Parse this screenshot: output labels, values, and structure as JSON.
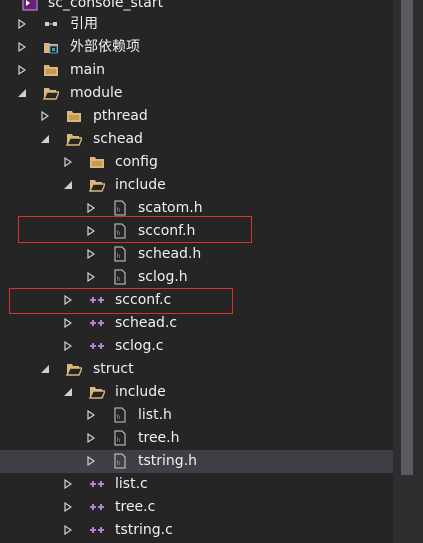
{
  "tree": {
    "items": [
      {
        "label": "sc_console_start",
        "icon": "solution-icon",
        "arrow": "none"
      },
      {
        "label": "引用",
        "icon": "references-icon",
        "arrow": "collapsed"
      },
      {
        "label": "外部依赖项",
        "icon": "external-deps-icon",
        "arrow": "collapsed"
      },
      {
        "label": "main",
        "icon": "folder-icon",
        "arrow": "collapsed"
      },
      {
        "label": "module",
        "icon": "folder-open-icon",
        "arrow": "expanded"
      },
      {
        "label": "pthread",
        "icon": "folder-icon",
        "arrow": "collapsed"
      },
      {
        "label": "schead",
        "icon": "folder-open-icon",
        "arrow": "expanded"
      },
      {
        "label": "config",
        "icon": "folder-icon",
        "arrow": "collapsed"
      },
      {
        "label": "include",
        "icon": "folder-open-icon",
        "arrow": "expanded"
      },
      {
        "label": "scatom.h",
        "icon": "header-file-icon",
        "arrow": "collapsed"
      },
      {
        "label": "scconf.h",
        "icon": "header-file-icon",
        "arrow": "collapsed"
      },
      {
        "label": "schead.h",
        "icon": "header-file-icon",
        "arrow": "collapsed"
      },
      {
        "label": "sclog.h",
        "icon": "header-file-icon",
        "arrow": "collapsed"
      },
      {
        "label": "scconf.c",
        "icon": "c-file-icon",
        "arrow": "collapsed"
      },
      {
        "label": "schead.c",
        "icon": "c-file-icon",
        "arrow": "collapsed"
      },
      {
        "label": "sclog.c",
        "icon": "c-file-icon",
        "arrow": "collapsed"
      },
      {
        "label": "struct",
        "icon": "folder-open-icon",
        "arrow": "expanded"
      },
      {
        "label": "include",
        "icon": "folder-open-icon",
        "arrow": "expanded"
      },
      {
        "label": "list.h",
        "icon": "header-file-icon",
        "arrow": "collapsed"
      },
      {
        "label": "tree.h",
        "icon": "header-file-icon",
        "arrow": "collapsed"
      },
      {
        "label": "tstring.h",
        "icon": "header-file-icon",
        "arrow": "collapsed",
        "selected": true
      },
      {
        "label": "list.c",
        "icon": "c-file-icon",
        "arrow": "collapsed"
      },
      {
        "label": "tree.c",
        "icon": "c-file-icon",
        "arrow": "collapsed"
      },
      {
        "label": "tstring.c",
        "icon": "c-file-icon",
        "arrow": "collapsed"
      }
    ]
  },
  "colors": {
    "background": "#252526",
    "text": "#f1f1f1",
    "selected_row": "#3f3f46",
    "folder": "#dcb67a",
    "header_file": "#b180d7",
    "c_file": "#b180d7",
    "highlight_box": "#e0302a"
  }
}
